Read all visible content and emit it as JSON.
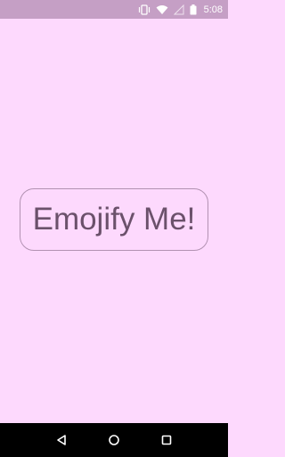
{
  "status_bar": {
    "time": "5:08",
    "icons": [
      "vibrate-icon",
      "wifi-icon",
      "signal-icon",
      "battery-icon"
    ]
  },
  "main": {
    "button_label": "Emojify Me!"
  },
  "nav_bar": {
    "buttons": [
      "back-icon",
      "home-icon",
      "recents-icon"
    ]
  },
  "colors": {
    "background": "#fdd9fd",
    "status_bar": "#c59fc5",
    "button_border": "#b292b2",
    "button_text": "#6b516b",
    "nav_bar": "#000000"
  }
}
